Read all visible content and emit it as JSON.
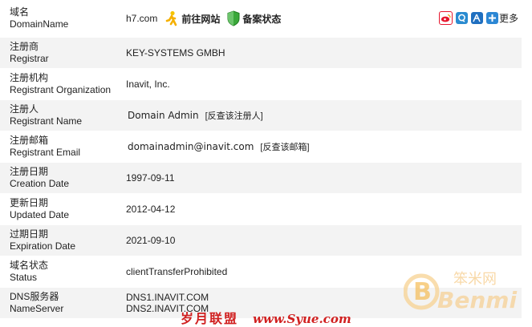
{
  "rows": [
    {
      "zh": "域名",
      "en": "DomainName",
      "value": "h7.com"
    },
    {
      "zh": "注册商",
      "en": "Registrar",
      "value": "KEY-SYSTEMS GMBH"
    },
    {
      "zh": "注册机构",
      "en": "Registrant Organization",
      "value": "Inavit, Inc."
    },
    {
      "zh": "注册人",
      "en": "Registrant Name",
      "value": "Domain Admin"
    },
    {
      "zh": "注册邮箱",
      "en": "Registrant Email",
      "value": "domainadmin@inavit.com"
    },
    {
      "zh": "注册日期",
      "en": "Creation Date",
      "value": "1997-09-11"
    },
    {
      "zh": "更新日期",
      "en": "Updated Date",
      "value": "2012-04-12"
    },
    {
      "zh": "过期日期",
      "en": "Expiration Date",
      "value": "2021-09-10"
    },
    {
      "zh": "域名状态",
      "en": "Status",
      "value": "clientTransferProhibited"
    },
    {
      "zh": "DNS服务器",
      "en": "NameServer",
      "value": [
        "DNS1.INAVIT.COM",
        "DNS2.INAVIT.COM"
      ]
    }
  ],
  "actions": {
    "goto_site": "前往网站",
    "beian_status": "备案状态",
    "lookup_registrant": "[反查该注册人]",
    "lookup_email": "[反查该邮箱]"
  },
  "share": {
    "more": "更多",
    "icons": [
      "weibo-icon",
      "qzone-icon",
      "renren-icon",
      "add-share-icon"
    ],
    "colors": {
      "weibo": "#e6162d",
      "qzone": "#2a8bd0",
      "renren": "#1f6fc0",
      "add": "#2c87d4"
    }
  },
  "watermark": {
    "cn": "笨米网",
    "en": "Benmi"
  },
  "footer": {
    "text": "岁月联盟",
    "domain": "www.Syue.com"
  }
}
